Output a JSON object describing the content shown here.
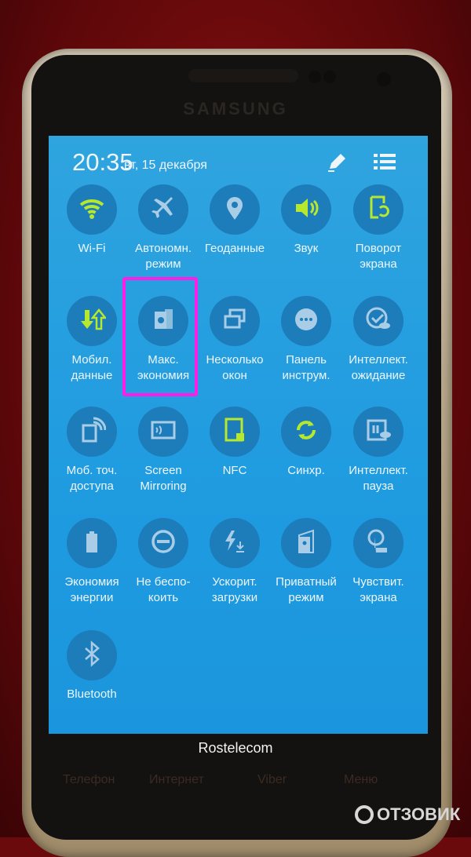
{
  "device": {
    "brand": "SAMSUNG"
  },
  "header": {
    "time": "20:35",
    "date": "вт, 15 декабря",
    "edit_icon": "pencil-icon",
    "list_icon": "list-icon"
  },
  "colors": {
    "screen": "#1f9be0",
    "tile_circle": "#1d7cba",
    "active_icon": "#b6e92e",
    "inactive_icon": "#a9cde6",
    "highlight": "#ff1ee8"
  },
  "tiles": [
    {
      "label": "Wi-Fi",
      "icon": "wifi-icon",
      "active": true
    },
    {
      "label": "Автономн.\nрежим",
      "icon": "airplane-icon",
      "active": false
    },
    {
      "label": "Геоданные",
      "icon": "location-icon",
      "active": false
    },
    {
      "label": "Звук",
      "icon": "sound-icon",
      "active": true
    },
    {
      "label": "Поворот\nэкрана",
      "icon": "rotate-icon",
      "active": true
    },
    {
      "label": "Мобил.\nданные",
      "icon": "mobile-data-icon",
      "active": true
    },
    {
      "label": "Макс.\nэкономия",
      "icon": "ultra-power-saving-icon",
      "active": false,
      "highlighted": true
    },
    {
      "label": "Несколько\nокон",
      "icon": "multi-window-icon",
      "active": false
    },
    {
      "label": "Панель\nинструм.",
      "icon": "toolbox-icon",
      "active": false
    },
    {
      "label": "Интеллект.\nожидание",
      "icon": "smart-stay-icon",
      "active": false
    },
    {
      "label": "Моб. точ.\nдоступа",
      "icon": "hotspot-icon",
      "active": false
    },
    {
      "label": "Screen\nMirroring",
      "icon": "screen-mirroring-icon",
      "active": false
    },
    {
      "label": "NFC",
      "icon": "nfc-icon",
      "active": true
    },
    {
      "label": "Синхр.",
      "icon": "sync-icon",
      "active": true
    },
    {
      "label": "Интеллект.\nпауза",
      "icon": "smart-pause-icon",
      "active": false
    },
    {
      "label": "Экономия\nэнергии",
      "icon": "power-saving-icon",
      "active": false
    },
    {
      "label": "Не беспо-\nкоить",
      "icon": "do-not-disturb-icon",
      "active": false
    },
    {
      "label": "Ускорит.\nзагрузки",
      "icon": "download-booster-icon",
      "active": false
    },
    {
      "label": "Приватный\nрежим",
      "icon": "private-mode-icon",
      "active": false
    },
    {
      "label": "Чувствит.\nэкрана",
      "icon": "touch-sensitivity-icon",
      "active": false
    },
    {
      "label": "Bluetooth",
      "icon": "bluetooth-icon",
      "active": false
    }
  ],
  "operator": "Rostelecom",
  "dock": [
    "Телефон",
    "Интернет",
    "Viber",
    "Меню"
  ],
  "watermark": "ОТЗОВИК"
}
